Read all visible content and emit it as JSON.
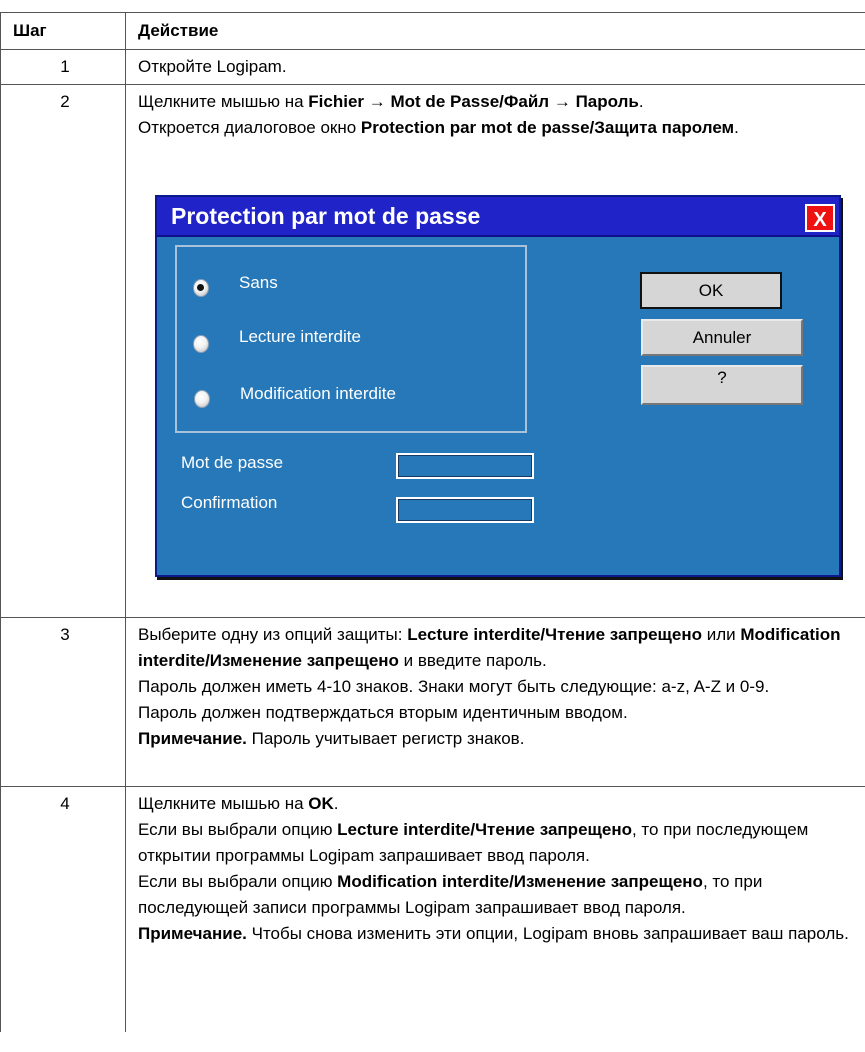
{
  "table": {
    "headers": [
      "Шаг",
      "Действие"
    ],
    "rows": [
      {
        "num": "1",
        "text": "Откройте Logipam."
      },
      {
        "num": "2",
        "line1": {
          "t1": "Щелкните мышью на ",
          "b1": "Fichier",
          "t2": " → ",
          "b2": "Mot de Passe",
          "t3": "/",
          "b3": "Файл",
          "t4": " → ",
          "b4": "Пароль",
          "t5": "."
        },
        "line2": {
          "t1": "Откроется диалоговое окно ",
          "b1": "Protection par mot de passe",
          "t2": "/",
          "b2": "Защита паролем",
          "t3": "."
        }
      },
      {
        "num": "3",
        "p1": {
          "t1": "Выберите одну из опций защиты: ",
          "b1": "Lecture interdite",
          "t2": "/",
          "b2": "Чтение запрещено",
          "t3": " или ",
          "b3": "Modification interdite",
          "t4": "/",
          "b4": "Изменение запрещено",
          "t5": " и введите пароль."
        },
        "p2": "Пароль должен иметь 4-10 знаков. Знаки могут быть следующие: a-z, A-Z и 0-9.",
        "p3": "Пароль должен подтверждаться вторым идентичным вводом.",
        "p4": {
          "b1": "Примечание.",
          "t1": " Пароль учитывает регистр знаков."
        }
      },
      {
        "num": "4",
        "p1": {
          "t1": "Щелкните мышью на ",
          "b1": "OK",
          "t2": "."
        },
        "p2": {
          "t1": "Если вы выбрали опцию ",
          "b1": "Lecture interdite",
          "t2": "/",
          "b2": "Чтение запрещено",
          "t3": ", то при последующем открытии программы Logipam запрашивает ввод пароля."
        },
        "p3": {
          "t1": "Если вы выбрали опцию  ",
          "b1": "Modification interdite",
          "t2": "/",
          "b2": "Изменение запрещено",
          "t3": ", то при последующей записи программы Logipam запрашивает ввод пароля."
        },
        "p4": {
          "b1": "Примечание.",
          "t1": " Чтобы снова изменить эти опции, Logipam вновь запрашивает ваш пароль."
        }
      }
    ]
  },
  "dialog": {
    "title": "Protection par mot de passe",
    "close_label": "X",
    "options": [
      "Sans",
      "Lecture interdite",
      "Modification interdite"
    ],
    "selected_option": "Sans",
    "buttons": {
      "ok": "OK",
      "cancel": "Annuler",
      "help": "?"
    },
    "fields": {
      "password_label": "Mot de passe",
      "confirm_label": "Confirmation",
      "password_value": "",
      "confirm_value": ""
    },
    "colors": {
      "body": "#2678b8",
      "titlebar": "#1f23c8",
      "close": "#ee1111",
      "button": "#d6d6d6"
    }
  }
}
